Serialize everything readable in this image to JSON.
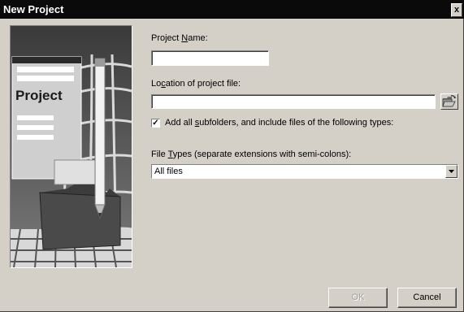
{
  "window": {
    "title": "New Project",
    "close_glyph": "x"
  },
  "illustration": {
    "caption": "Project",
    "icon": "project-folder-pencil-illustration"
  },
  "project_name": {
    "label_pre": "Project ",
    "label_accel": "N",
    "label_post": "ame:",
    "value": ""
  },
  "location": {
    "label_pre": "Lo",
    "label_accel": "c",
    "label_post": "ation of project file:",
    "value": "",
    "browse_icon": "folder-open-icon"
  },
  "include_subfolders": {
    "checked": true,
    "check_glyph": "✓",
    "label_pre": "Add all ",
    "label_accel": "s",
    "label_post": "ubfolders, and include files of the following types:"
  },
  "file_types": {
    "label_pre": "File ",
    "label_accel": "T",
    "label_post": "ypes (separate extensions with semi-colons):",
    "selected": "All files"
  },
  "buttons": {
    "ok": "OK",
    "cancel": "Cancel",
    "ok_enabled": false
  },
  "colors": {
    "title_bar": "#0a0a0a",
    "dialog_face": "#d4d0c8"
  }
}
